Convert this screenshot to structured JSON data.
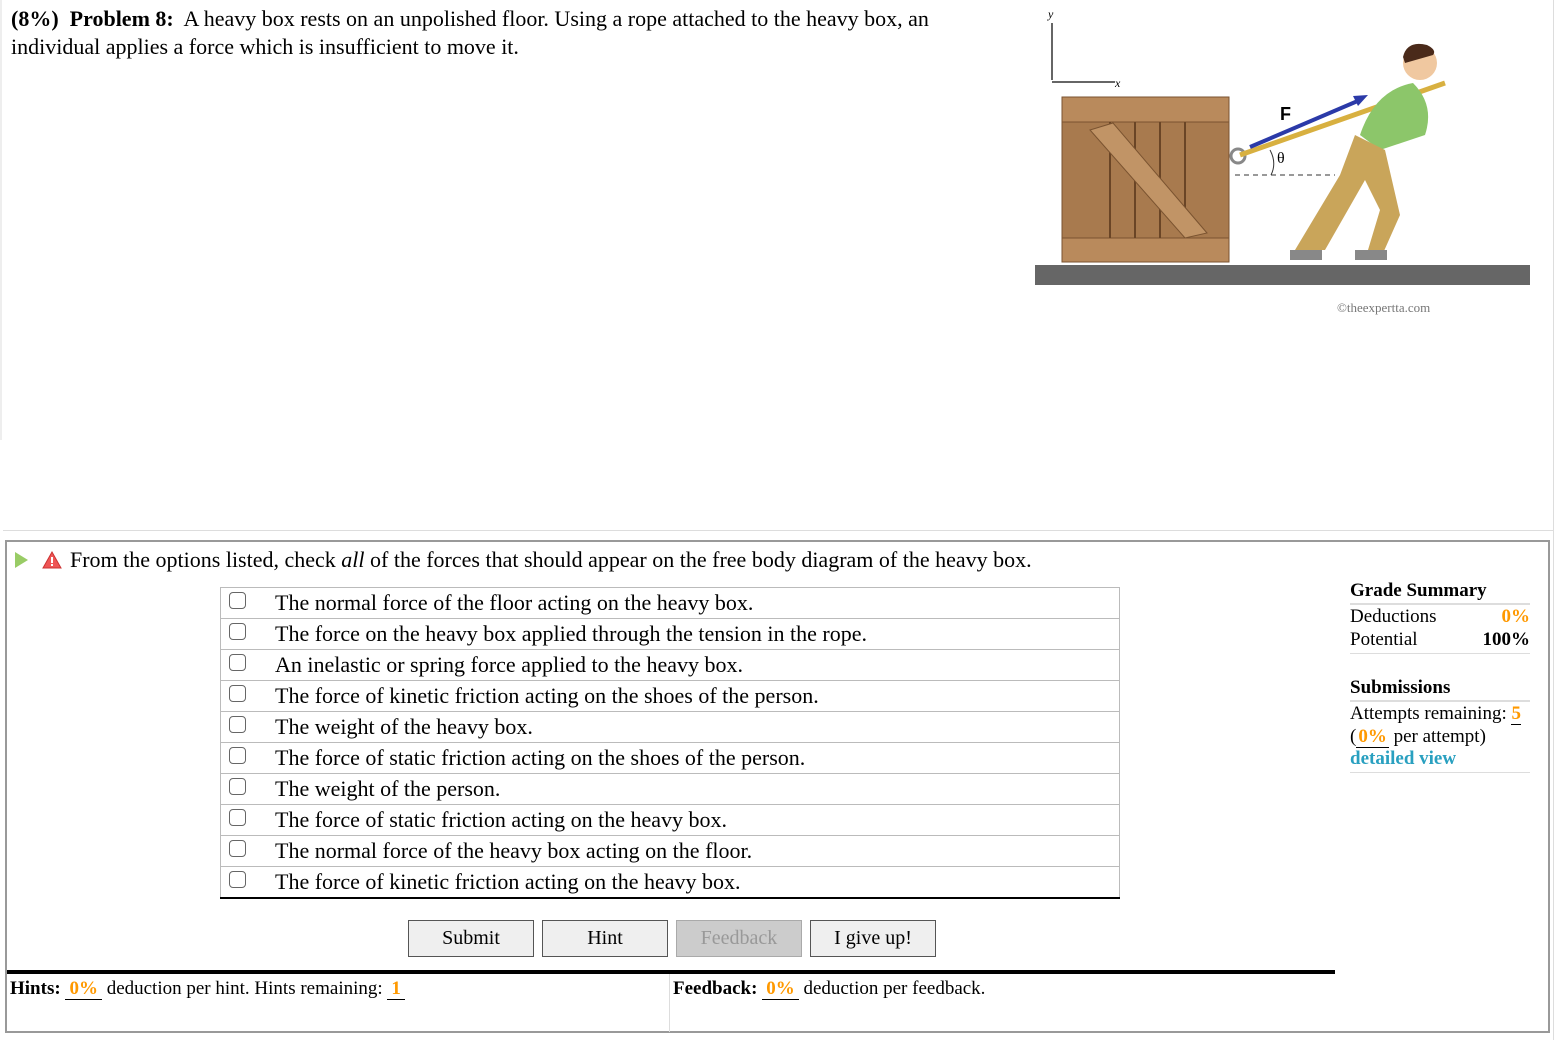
{
  "problem": {
    "percent": "(8%)",
    "label": "Problem 8:",
    "text": "A heavy box rests on an unpolished floor. Using a rope attached to the heavy box, an individual applies a force which is insufficient to move it."
  },
  "figure": {
    "axis_y": "y",
    "axis_x": "x",
    "force_label": "F",
    "angle_label": "θ",
    "credit": "©theexpertta.com"
  },
  "question": {
    "pre": "From the options listed, check ",
    "emph": "all",
    "post": " of the forces that should appear on the free body diagram of the heavy box.",
    "options": [
      "The normal force of the floor acting on the heavy box.",
      "The force on the heavy box applied through the tension in the rope.",
      "An inelastic or spring force applied to the heavy box.",
      "The force of kinetic friction acting on the shoes of the person.",
      "The weight of the heavy box.",
      "The force of static friction acting on the shoes of the person.",
      "The weight of the person.",
      "The force of static friction acting on the heavy box.",
      "The normal force of the heavy box acting on the floor.",
      "The force of kinetic friction acting on the heavy box."
    ]
  },
  "buttons": {
    "submit": "Submit",
    "hint": "Hint",
    "feedback": "Feedback",
    "give_up": "I give up!"
  },
  "hints": {
    "label": "Hints:",
    "deduction": "0%",
    "text": "deduction per hint. Hints remaining:",
    "remaining": "1"
  },
  "feedback": {
    "label": "Feedback:",
    "deduction": "0%",
    "text": "deduction per feedback."
  },
  "grade_summary": {
    "title": "Grade Summary",
    "deductions_label": "Deductions",
    "deductions": "0%",
    "potential_label": "Potential",
    "potential": "100%"
  },
  "submissions": {
    "title": "Submissions",
    "attempts_label": "Attempts remaining:",
    "attempts": "5",
    "per_attempt_open": "(",
    "per_attempt": "0%",
    "per_attempt_text": "per attempt)",
    "detailed_view": "detailed view"
  },
  "colors": {
    "accent": "#ff9900",
    "link": "#29a0c0",
    "force_arrow": "#2b3aa8"
  }
}
